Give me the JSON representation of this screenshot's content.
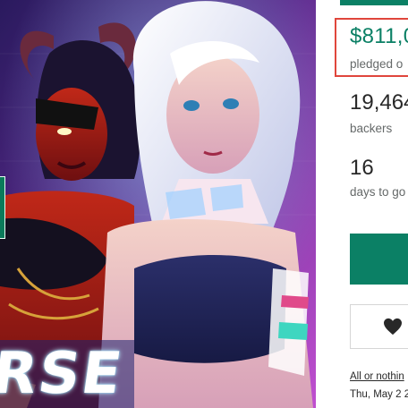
{
  "campaign": {
    "pledged_amount": "$811,0",
    "pledged_label": "pledged o",
    "backers_count": "19,464",
    "backers_label": "backers",
    "days_count": "16",
    "days_label": "days to go",
    "funding_link": "All or nothin",
    "end_date": "Thu, May 2 2"
  },
  "artwork": {
    "logo_text": "RSE"
  },
  "colors": {
    "accent_green": "#0b8065",
    "highlight_red": "#e0463c"
  },
  "icons": {
    "remind_button": "heart-icon"
  }
}
